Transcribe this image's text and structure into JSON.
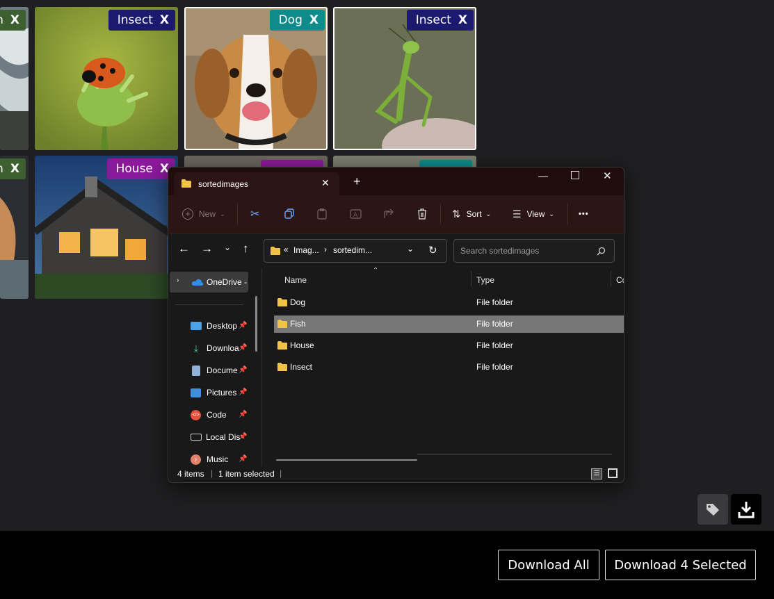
{
  "gallery": {
    "tiles": [
      {
        "tag": "h",
        "color": "#3e5f30"
      },
      {
        "tag": "Insect",
        "color": "#1b1a6e"
      },
      {
        "tag": "Dog",
        "color": "#0f8b8b"
      },
      {
        "tag": "Insect",
        "color": "#1b1a6e"
      },
      {
        "tag": "h",
        "color": "#3e5f30"
      },
      {
        "tag": "House",
        "color": "#8a1a9a"
      }
    ],
    "tag_close": "X"
  },
  "explorer": {
    "tab_title": "sortedimages",
    "new_tab": "+",
    "toolbar": {
      "new": "New",
      "sort": "Sort",
      "view": "View",
      "more": "•••"
    },
    "address": {
      "prefix": "«",
      "seg1": "Imag...",
      "sep": "›",
      "seg2": "sortedim..."
    },
    "search_placeholder": "Search sortedimages",
    "nav": {
      "onedrive": "OneDrive -",
      "items": [
        "Desktop",
        "Downloa",
        "Docume",
        "Pictures",
        "Code",
        "Local Dis",
        "Music"
      ]
    },
    "columns": {
      "name": "Name",
      "type": "Type",
      "extra": "Co"
    },
    "files": [
      {
        "name": "Dog",
        "type": "File folder"
      },
      {
        "name": "Fish",
        "type": "File folder"
      },
      {
        "name": "House",
        "type": "File folder"
      },
      {
        "name": "Insect",
        "type": "File folder"
      }
    ],
    "status": {
      "count": "4 items",
      "selected": "1 item selected"
    }
  },
  "actions": {
    "download_all": "Download All",
    "download_selected": "Download 4 Selected"
  },
  "colors": {
    "insect": "#1b1a6e",
    "dog": "#0f8b8b",
    "house": "#8a1a9a",
    "fish": "#3e5f30",
    "folder": "#f0c24a"
  }
}
